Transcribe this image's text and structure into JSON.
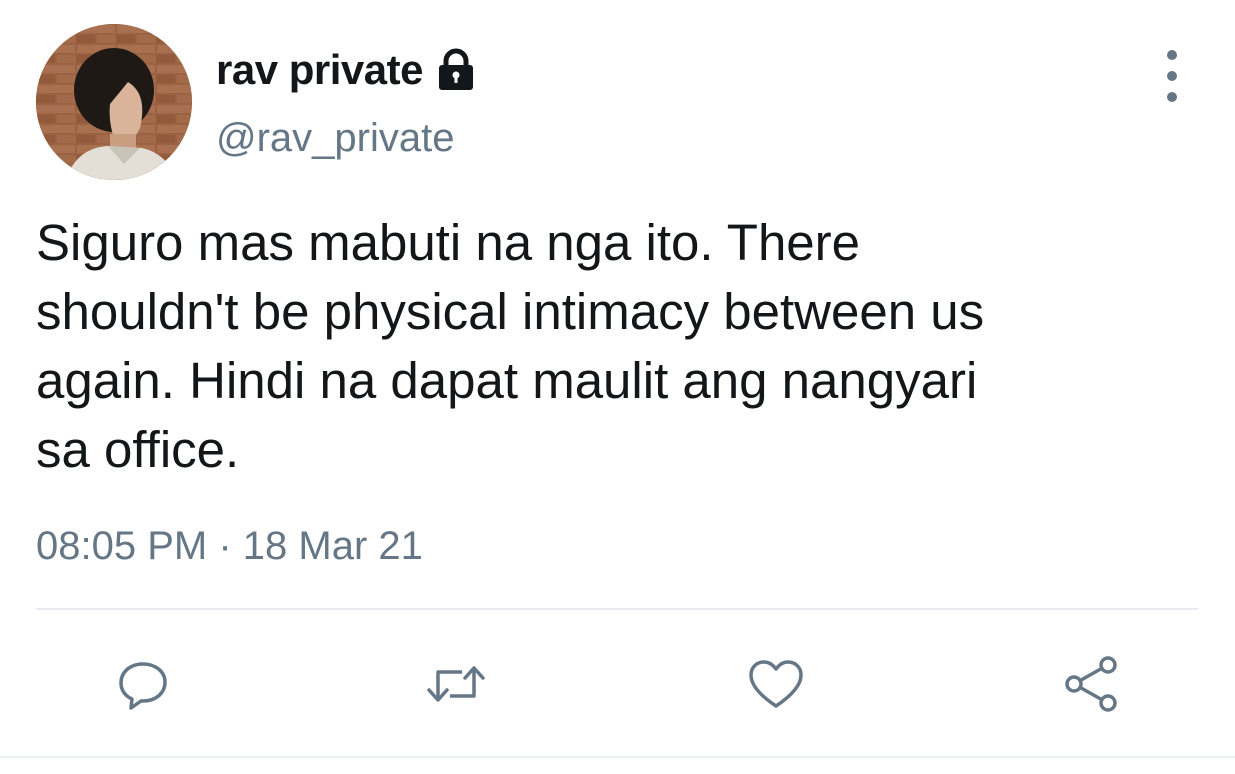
{
  "tweet": {
    "display_name": "rav private",
    "handle": "@rav_private",
    "protected_icon": "lock-icon",
    "more_icon": "more-vertical-icon",
    "text": "Siguro mas mabuti na nga ito. There\nshouldn't be physical intimacy between us\nagain. Hindi na dapat maulit ang nangyari\nsa office.",
    "time": "08:05 PM",
    "separator": " · ",
    "date": "18 Mar 21"
  },
  "actions": [
    {
      "name": "reply",
      "icon": "speech-bubble-icon"
    },
    {
      "name": "retweet",
      "icon": "retweet-arrows-icon"
    },
    {
      "name": "like",
      "icon": "heart-icon"
    },
    {
      "name": "share",
      "icon": "share-nodes-icon"
    }
  ],
  "colors": {
    "text": "#14171a",
    "secondary": "#657786",
    "divider": "#e6ecf0",
    "background": "#ffffff"
  }
}
